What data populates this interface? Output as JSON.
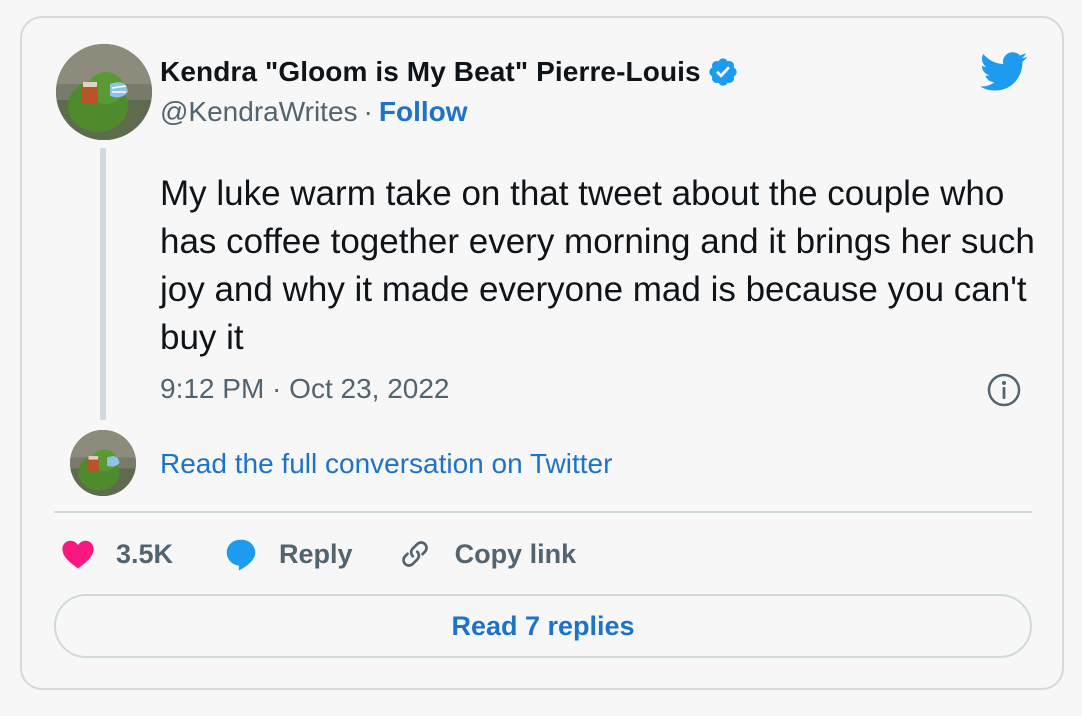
{
  "tweet": {
    "author": {
      "display_name": "Kendra \"Gloom is My Beat\" Pierre-Louis",
      "handle": "@KendraWrites",
      "separator": "·",
      "follow_label": "Follow",
      "verified": true
    },
    "text": "My luke warm take on that tweet about the couple who has coffee together every morning and it brings her such joy and why it made everyone mad is because you can't buy it",
    "timestamp": "9:12 PM · Oct 23, 2022",
    "read_conversation_label": "Read the full conversation on Twitter",
    "actions": {
      "like_count": "3.5K",
      "reply_label": "Reply",
      "copy_link_label": "Copy link"
    },
    "read_replies_label": "Read 7 replies"
  },
  "colors": {
    "link_blue": "#1d73c9",
    "twitter_blue": "#1d9bf0",
    "like_pink": "#f91880",
    "text_primary": "#0f1419",
    "text_secondary": "#536471",
    "border": "#cfd9de",
    "background": "#f7f7f7"
  },
  "icons": {
    "verified": "verified-badge-icon",
    "logo": "twitter-bird-icon",
    "info": "info-icon",
    "like": "heart-icon",
    "reply": "speech-bubble-icon",
    "copy_link": "link-icon"
  }
}
